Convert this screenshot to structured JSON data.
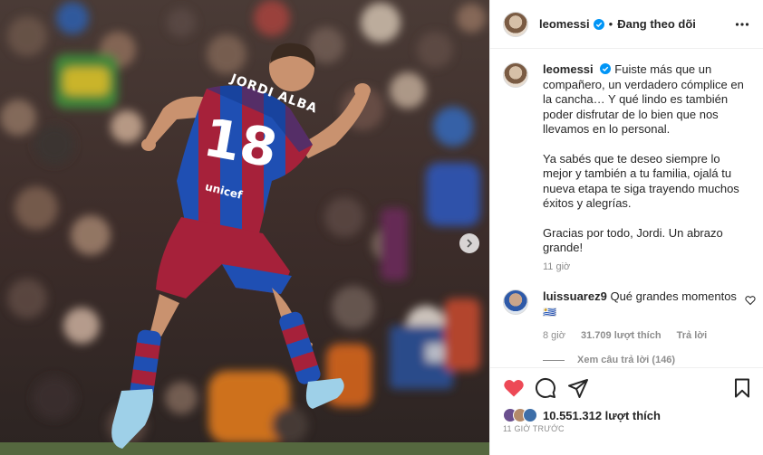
{
  "post": {
    "author": "leomessi",
    "follow_status": "Đang theo dõi",
    "caption": [
      "Fuiste más que un compañero, un verdadero cómplice en la cancha… Y qué lindo es también poder disfrutar de lo bien que nos llevamos en lo personal.",
      "Ya sabés que te deseo siempre lo mejor y también a tu familia, ojalá tu nueva etapa te siga trayendo muchos éxitos y alegrías.",
      "Gracias por todo, Jordi. Un abrazo grande!"
    ],
    "caption_time": "11 giờ",
    "jersey_name": "JORDI ALBA",
    "jersey_number": "18",
    "sponsor": "unicef",
    "likes": "10.551.312 lượt thích",
    "time_ago": "11 GIỜ TRƯỚC"
  },
  "comments": [
    {
      "user": "luissuarez9",
      "text": "Qué grandes momentos",
      "emoji": "🇺🇾",
      "time": "8 giờ",
      "likes": "31.709 lượt thích",
      "reply_label": "Trả lời",
      "view_replies": "Xem câu trả lời (146)"
    }
  ],
  "icons": {
    "verified": "verified-badge-icon",
    "more": "more-horizontal-icon",
    "like": "heart-filled-icon",
    "comment": "comment-bubble-icon",
    "share": "paper-plane-icon",
    "save": "bookmark-icon",
    "next": "chevron-right-icon"
  },
  "colors": {
    "like_red": "#ed4956",
    "verified_blue": "#0095f6",
    "muted": "#8e8e8e",
    "barca_blue": "#1f4fb3",
    "barca_red": "#a6213a"
  }
}
